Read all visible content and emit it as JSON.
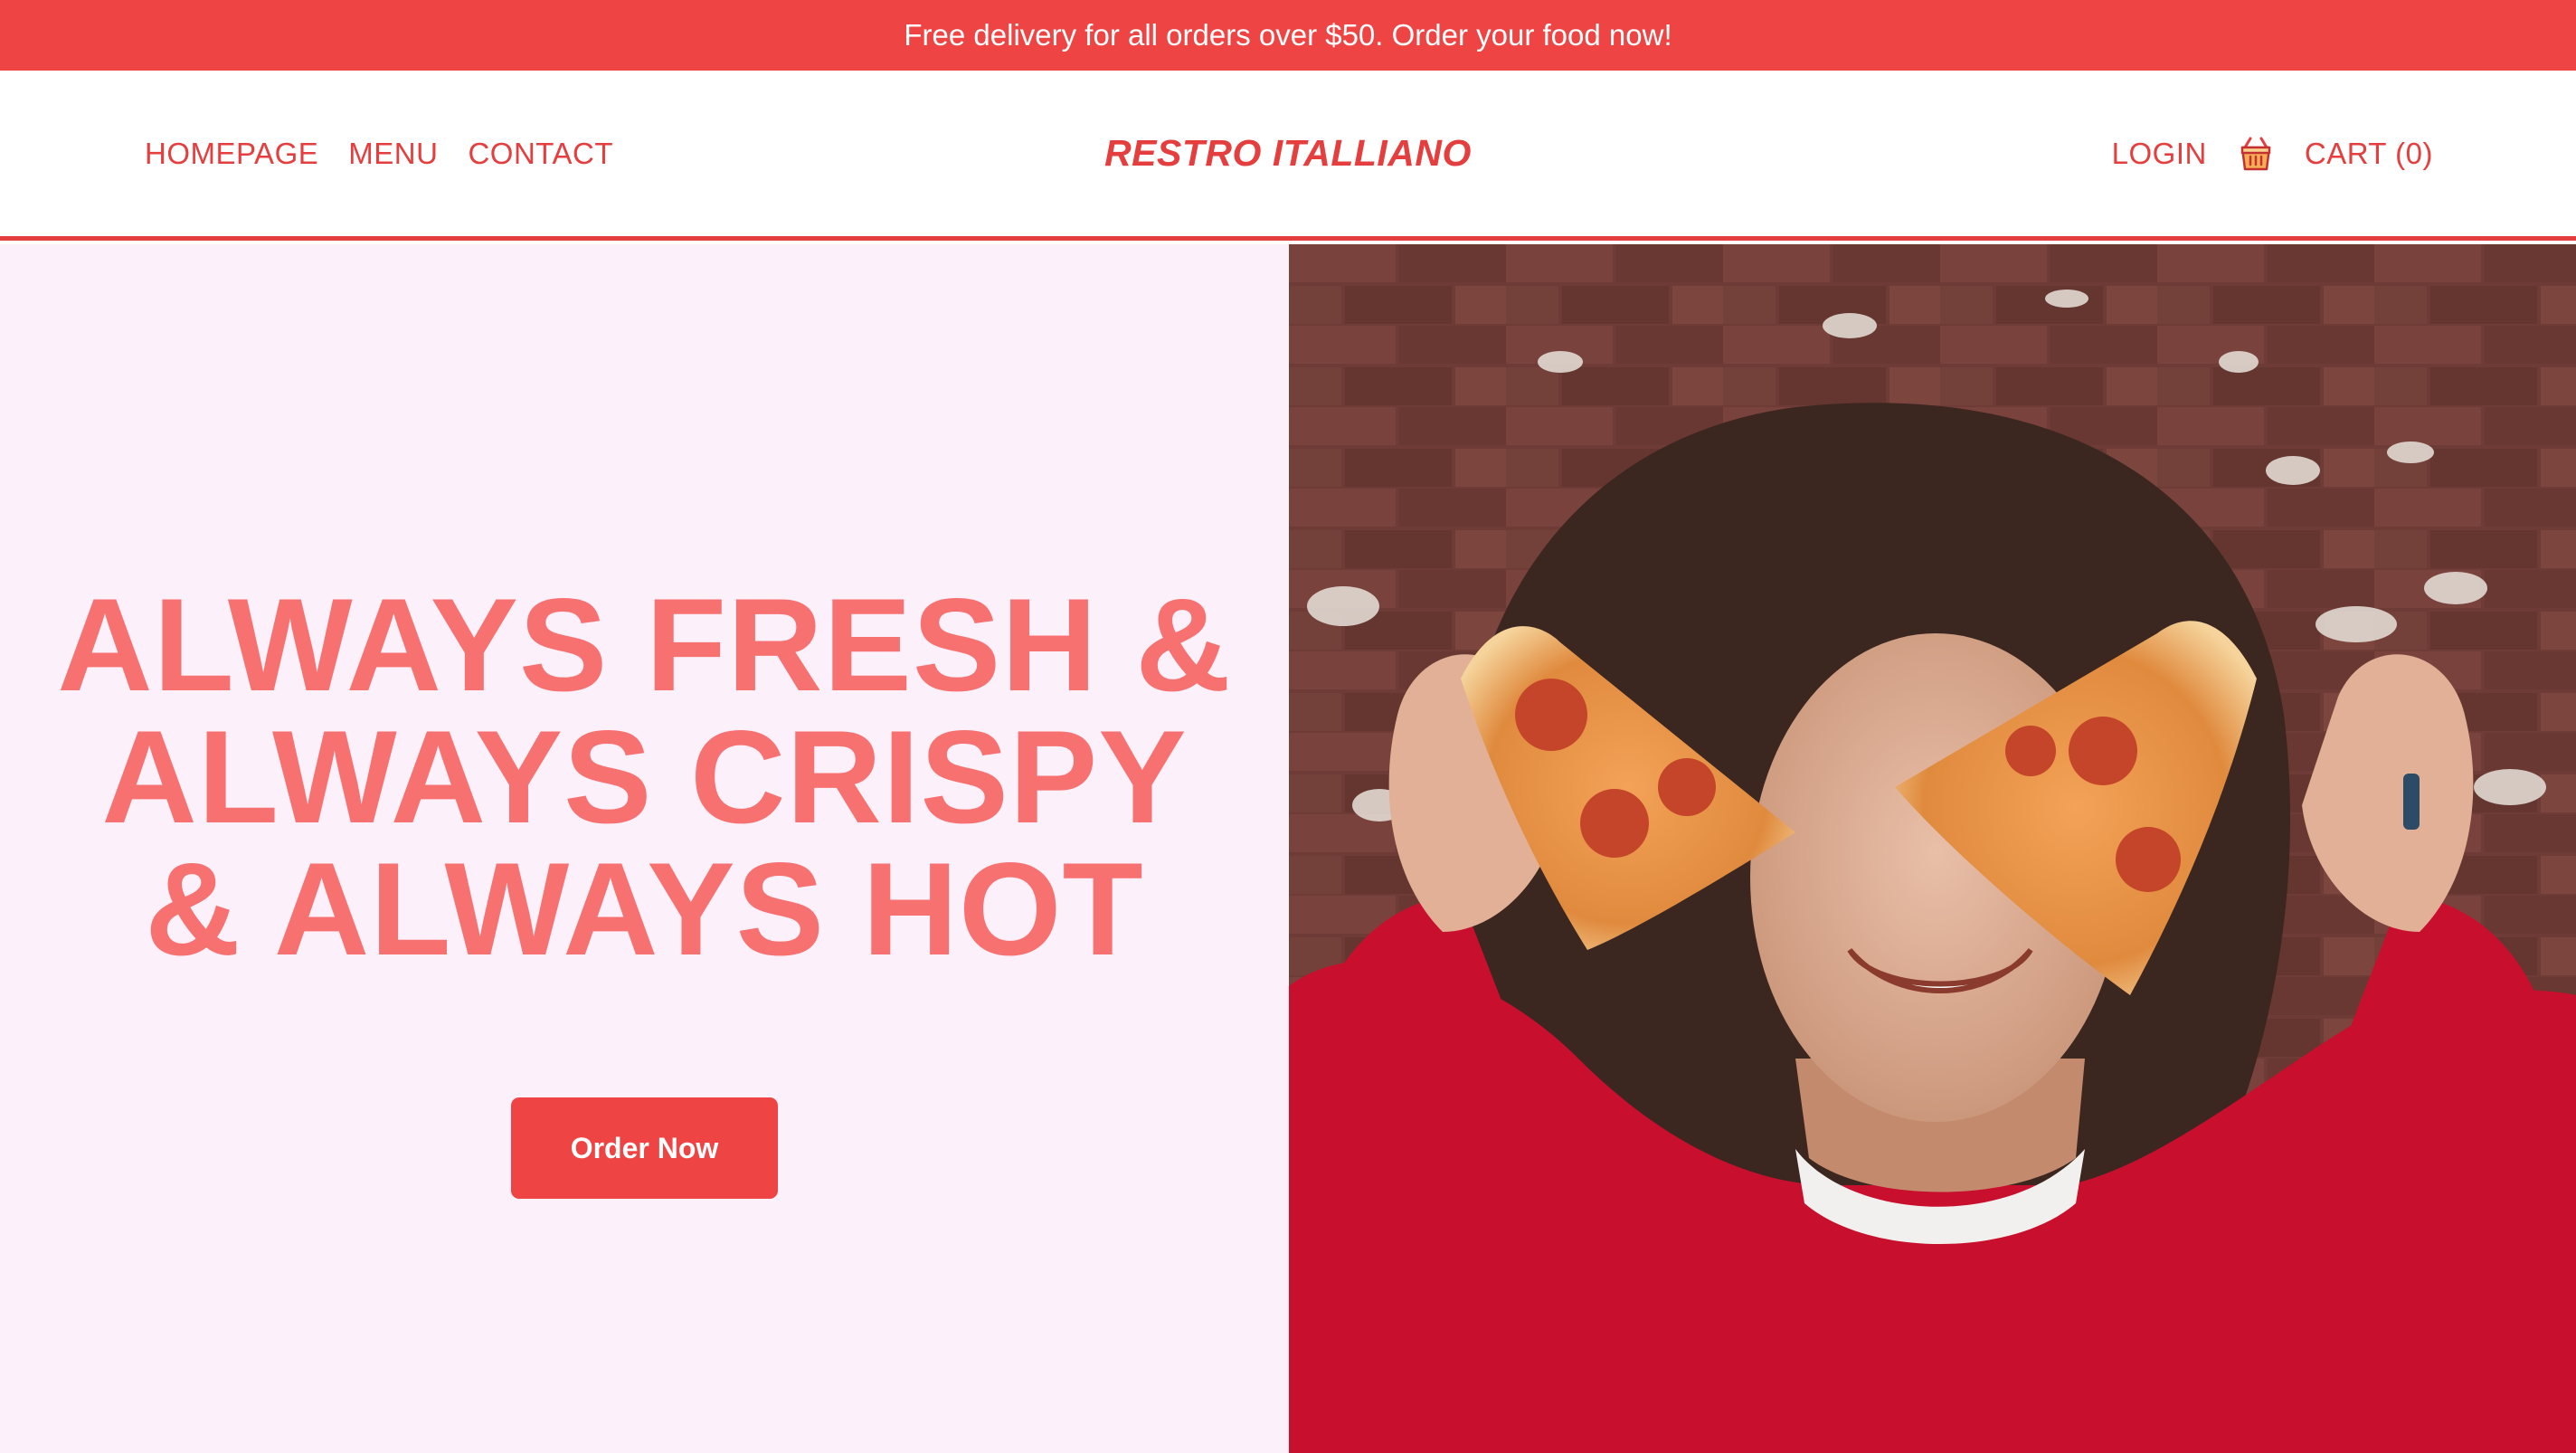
{
  "announcement": {
    "text": "Free delivery for all orders over $50. Order your food now!"
  },
  "nav": {
    "left_links": [
      {
        "label": "HOMEPAGE"
      },
      {
        "label": "MENU"
      },
      {
        "label": "CONTACT"
      }
    ],
    "brand": "RESTRO ITALLIANO",
    "login_label": "LOGIN",
    "cart_icon": "shopping-basket-icon",
    "cart_label": "CART (0)"
  },
  "hero": {
    "headline_lines": [
      "ALWAYS FRESH &",
      "ALWAYS CRISPY",
      "& ALWAYS HOT"
    ],
    "cta_label": "Order Now",
    "image_subject": "person-holding-pizza-slices-over-eyes"
  },
  "colors": {
    "primary": "#ef4444",
    "nav_text": "#e53e3e",
    "headline": "#f87171",
    "hero_bg": "#fcf0fa"
  }
}
